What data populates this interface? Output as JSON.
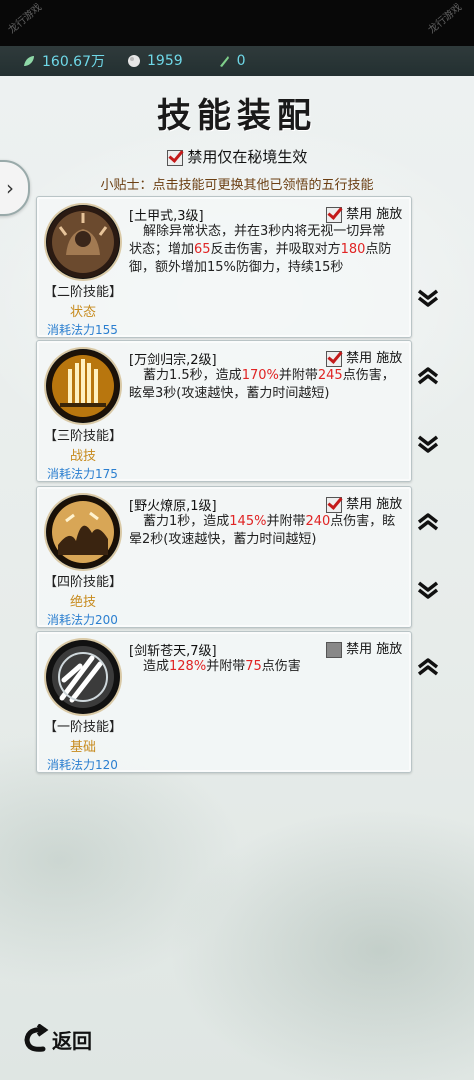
{
  "resources": [
    {
      "icon": "jade-leaf-icon",
      "value": "160.67万"
    },
    {
      "icon": "silver-ore-icon",
      "value": "1959"
    },
    {
      "icon": "green-gem-icon",
      "value": "0"
    }
  ],
  "title": "技能装配",
  "toggle": {
    "label": "禁用仅在秘境生效",
    "checked": true
  },
  "tip": "小贴士：点击技能可更换其他已领悟的五行技能",
  "options": {
    "disable_label": "禁用",
    "cast_label": "施放"
  },
  "skills": [
    {
      "name": "[土甲式,3级]",
      "tier": "【二阶技能】",
      "category": "状态",
      "cost": "消耗法力155",
      "disabled": true,
      "desc": [
        "解除异常状态，并在3秒内将无视一切异常状态；增加",
        "65",
        "反击伤害，并吸取对方",
        "180",
        "点防御，额外增加15%防御力，持续15秒"
      ]
    },
    {
      "name": "[万剑归宗,2级]",
      "tier": "【三阶技能】",
      "category": "战技",
      "cost": "消耗法力175",
      "disabled": true,
      "desc": [
        "蓄力1.5秒，造成",
        "170%",
        "并附带",
        "245",
        "点伤害，眩晕3秒(攻速越快，蓄力时间越短)"
      ]
    },
    {
      "name": "[野火燎原,1级]",
      "tier": "【四阶技能】",
      "category": "绝技",
      "cost": "消耗法力200",
      "disabled": true,
      "desc": [
        "蓄力1秒，造成",
        "145%",
        "并附带",
        "240",
        "点伤害，眩晕2秒(攻速越快，蓄力时间越短)"
      ]
    },
    {
      "name": "[剑斩苍天,7级]",
      "tier": "【一阶技能】",
      "category": "基础",
      "cost": "消耗法力120",
      "disabled": false,
      "desc": [
        "造成",
        "128%",
        "并附带",
        "75",
        "点伤害"
      ]
    }
  ],
  "back_label": "返回",
  "colors": {
    "accent_red": "#e02424",
    "category_gold": "#c78b1e",
    "cost_blue": "#2b7fd0",
    "resource_cyan": "#6fd8e8"
  }
}
